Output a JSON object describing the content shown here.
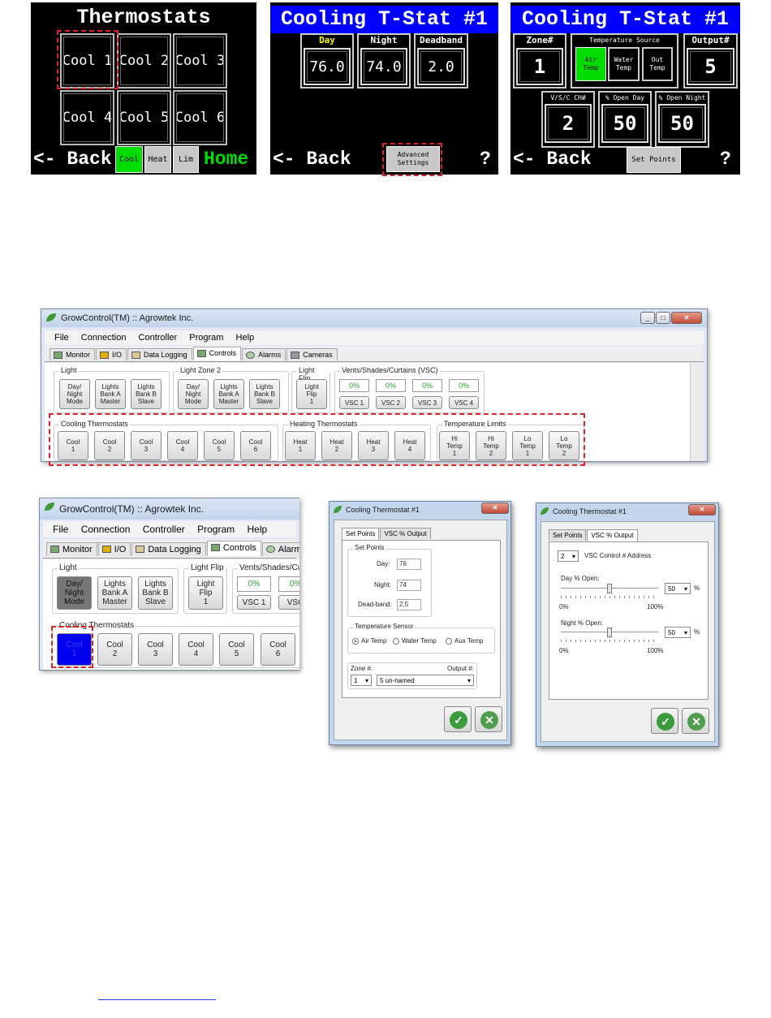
{
  "lcd1": {
    "title": "Thermostats",
    "tiles": [
      "Cool 1",
      "Cool 2",
      "Cool 3",
      "Cool 4",
      "Cool 5",
      "Cool 6"
    ],
    "back": "<- Back",
    "modes": [
      "Cool",
      "Heat",
      "Lim"
    ],
    "home": "Home"
  },
  "lcd2": {
    "title": "Cooling T-Stat #1",
    "day_label": "Day",
    "day_value": "76.0",
    "night_label": "Night",
    "night_value": "74.0",
    "deadband_label": "Deadband",
    "deadband_value": "2.0",
    "back": "<- Back",
    "advanced": "Advanced Settings",
    "help": "?"
  },
  "lcd3": {
    "title": "Cooling T-Stat #1",
    "zone_label": "Zone#",
    "zone_value": "1",
    "source_label": "Temperature Source",
    "sources": [
      "Air Temp",
      "Water Temp",
      "Out Temp"
    ],
    "output_label": "Output#",
    "output_value": "5",
    "vsc_label": "V/S/C CH#",
    "vsc_value": "2",
    "openday_label": "% Open Day",
    "openday_value": "50",
    "opennight_label": "% Open Night",
    "opennight_value": "50",
    "back": "<- Back",
    "setpoints": "Set Points",
    "help": "?"
  },
  "app1": {
    "title": "GrowControl(TM) :: Agrowtek Inc.",
    "menu": [
      "File",
      "Connection",
      "Controller",
      "Program",
      "Help"
    ],
    "tabs": [
      "Monitor",
      "I/O",
      "Data Logging",
      "Controls",
      "Alarms",
      "Cameras"
    ],
    "groups": {
      "light": "Light",
      "light_zone2": "Light Zone 2",
      "light_flip": "Light Flip",
      "vsc": "Vents/Shades/Curtains (VSC)",
      "cooling": "Cooling Thermostats",
      "heating": "Heating Thermostats",
      "limits": "Temperature Limits"
    },
    "light_buttons": [
      "Day/\nNight\nMode",
      "Lights\nBank A\nMaster",
      "Lights\nBank B\nSlave"
    ],
    "lightflip_button": "Light\nFlip\n1",
    "vsc_pcts": [
      "0%",
      "0%",
      "0%",
      "0%"
    ],
    "vsc_buttons": [
      "VSC 1",
      "VSC 2",
      "VSC 3",
      "VSC 4"
    ],
    "cool_buttons": [
      "Cool\n1",
      "Cool\n2",
      "Cool\n3",
      "Cool\n4",
      "Cool\n5",
      "Cool\n6"
    ],
    "heat_buttons": [
      "Heat\n1",
      "Heat\n2",
      "Heat\n3",
      "Heat\n4"
    ],
    "limit_buttons": [
      "Hi\nTemp\n1",
      "Hi\nTemp\n2",
      "Lo\nTemp\n1",
      "Lo\nTemp\n2"
    ]
  },
  "app2": {
    "title": "GrowControl(TM) :: Agrowtek Inc.",
    "menu": [
      "File",
      "Connection",
      "Controller",
      "Program",
      "Help"
    ],
    "tabs": [
      "Monitor",
      "I/O",
      "Data Logging",
      "Controls",
      "Alarms"
    ],
    "light": "Light",
    "light_flip": "Light Flip",
    "vsc": "Vents/Shades/Cu",
    "light_buttons": [
      "Day/\nNight\nMode",
      "Lights\nBank A\nMaster",
      "Lights\nBank B\nSlave"
    ],
    "lightflip_button": "Light\nFlip\n1",
    "vsc_pcts": [
      "0%",
      "0%"
    ],
    "vsc_buttons": [
      "VSC 1",
      "VSC"
    ],
    "cooling": "Cooling Thermostats",
    "cool_buttons": [
      "Cool\n1",
      "Cool\n2",
      "Cool\n3",
      "Cool\n4",
      "Cool\n5",
      "Cool\n6"
    ]
  },
  "dlg1": {
    "title": "Cooling Thermostat #1",
    "tabs": [
      "Set Points",
      "VSC % Output"
    ],
    "setpoints_group": "Set Points",
    "day_label": "Day:",
    "day_value": "76",
    "night_label": "Night:",
    "night_value": "74",
    "deadband_label": "Dead-band:",
    "deadband_value": "2.5",
    "sensor_group": "Temperature Sensor",
    "sensors": [
      "Air Temp",
      "Water Temp",
      "Aux Temp"
    ],
    "zone_label": "Zone #:",
    "zone_value": "1",
    "output_label": "Output #:",
    "output_value": "5 un-named"
  },
  "dlg2": {
    "title": "Cooling Thermostat #1",
    "tabs": [
      "Set Points",
      "VSC % Output"
    ],
    "vsc_addr_value": "2",
    "vsc_addr_label": "VSC Control # Address",
    "day_label": "Day % Open:",
    "day_value": "50",
    "night_label": "Night % Open:",
    "night_value": "50",
    "pct": "%",
    "min": "0%",
    "max": "100%"
  },
  "colors": {
    "lcd_blue": "#0000ff",
    "lcd_green": "#00dd00",
    "highlight_red": "#d9242b",
    "cool_selected": "#0000ee"
  }
}
